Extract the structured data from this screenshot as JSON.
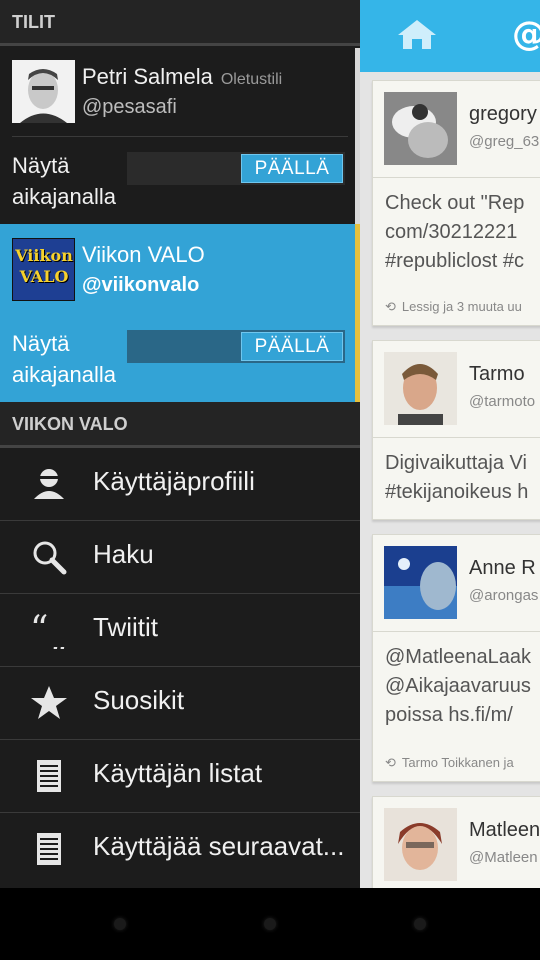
{
  "drawer": {
    "accounts_header": "TILIT",
    "accounts": [
      {
        "name": "Petri Salmela",
        "badge": "Oletustili",
        "handle": "@pesasafi",
        "show_label": "Näytä\naikajanalla",
        "toggle_label": "PÄÄLLÄ",
        "avatar_text": ""
      },
      {
        "name": "Viikon VALO",
        "badge": "",
        "handle": "@viikonvalo",
        "show_label": "Näytä\naikajanalla",
        "toggle_label": "PÄÄLLÄ",
        "avatar_text": "Viikon VALO"
      }
    ],
    "section_header": "VIIKON VALO",
    "menu": [
      {
        "label": "Käyttäjäprofiili",
        "icon": "user-icon"
      },
      {
        "label": "Haku",
        "icon": "search-icon"
      },
      {
        "label": "Twiitit",
        "icon": "quote-icon"
      },
      {
        "label": "Suosikit",
        "icon": "star-icon"
      },
      {
        "label": "Käyttäjän listat",
        "icon": "list-icon"
      },
      {
        "label": "Käyttäjää seuraavat...",
        "icon": "list-icon"
      }
    ]
  },
  "timeline": {
    "tweets": [
      {
        "name": "gregory",
        "handle": "@greg_63",
        "text": "Check out \"Rep\ncom/30212221\n#republiclost #c",
        "retweet": "Lessig ja 3 muuta uu"
      },
      {
        "name": "Tarmo",
        "handle": "@tarmoto",
        "text": "Digivaikuttaja Vi\n#tekijanoikeus h",
        "retweet": ""
      },
      {
        "name": "Anne R",
        "handle": "@arongas",
        "text": "@MatleenaLaak\n@Aikajaavaruus\npoissa hs.fi/m/",
        "retweet": "Tarmo Toikkanen ja"
      },
      {
        "name": "Matleen",
        "handle": "@Matleen",
        "text": "",
        "retweet": ""
      }
    ]
  },
  "colors": {
    "accent": "#33a3d6",
    "action_bar": "#35b5e8",
    "drawer_bg": "#1c1c1c",
    "selected_bar": "#e6c13e"
  }
}
